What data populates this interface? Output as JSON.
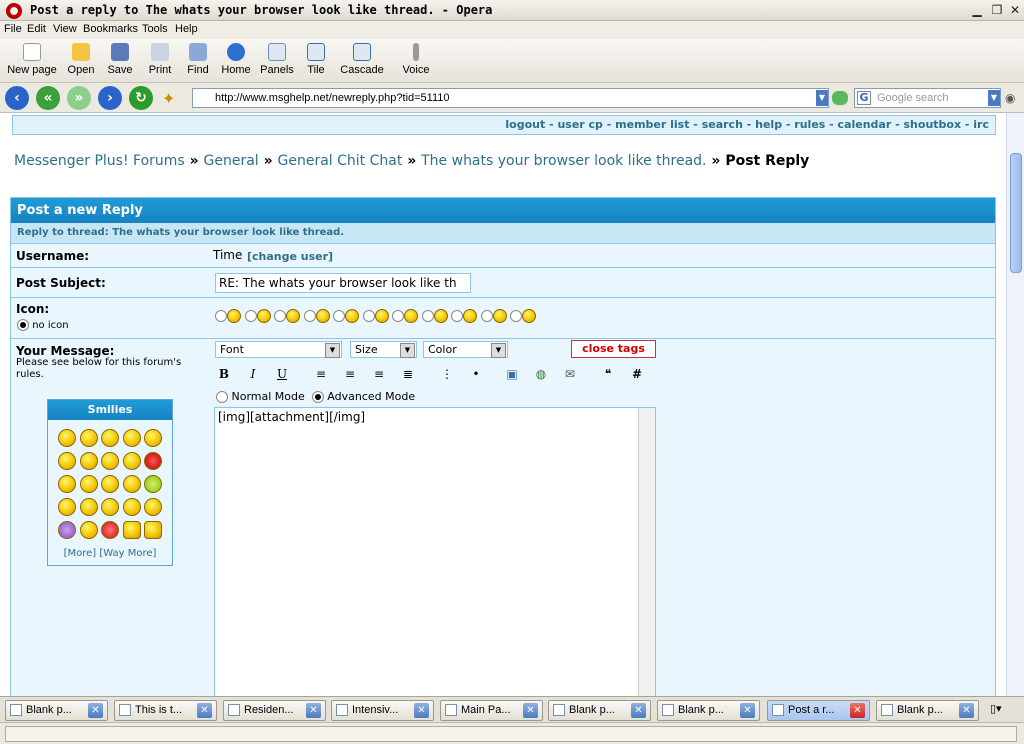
{
  "window": {
    "title": "Post a reply to The whats your browser look like thread. - Opera"
  },
  "menu": [
    "File",
    "Edit",
    "View",
    "Bookmarks",
    "Tools",
    "Help"
  ],
  "toolbar": [
    {
      "label": "New page",
      "icon": "new-page-icon"
    },
    {
      "label": "Open",
      "icon": "folder-icon"
    },
    {
      "label": "Save",
      "icon": "floppy-icon"
    },
    {
      "label": "Print",
      "icon": "printer-icon"
    },
    {
      "label": "Find",
      "icon": "binoculars-icon"
    },
    {
      "label": "Home",
      "icon": "home-icon"
    },
    {
      "label": "Panels",
      "icon": "panels-icon"
    },
    {
      "label": "Tile",
      "icon": "tile-icon"
    },
    {
      "label": "Cascade",
      "icon": "cascade-icon"
    },
    {
      "label": "Voice",
      "icon": "microphone-icon"
    }
  ],
  "address": {
    "url": "http://www.msghelp.net/newreply.php?tid=51110"
  },
  "search": {
    "placeholder": "Google search"
  },
  "page": {
    "toplinks": "logout - user cp - member list - search - help - rules - calendar - shoutbox - irc",
    "breadcrumb": {
      "part1": "Messenger Plus! Forums",
      "part2": "General",
      "part3": "General Chit Chat",
      "part4": "The whats your browser look like thread.",
      "current": "Post Reply",
      "sep": " » "
    },
    "form_title": "Post a new Reply",
    "reply_to": "Reply to thread: The whats your browser look like thread.",
    "username_label": "Username:",
    "username_value": "Time",
    "change_user": "[change user]",
    "subject_label": "Post Subject:",
    "subject_value": "RE: The whats your browser look like th",
    "icon_label": "Icon:",
    "no_icon": "no icon",
    "message_label": "Your Message:",
    "message_hint": "Please see below for this forum's rules.",
    "font_select": "Font",
    "size_select": "Size",
    "color_select": "Color",
    "close_tags": "close tags",
    "normal_mode": "Normal Mode",
    "advanced_mode": "Advanced Mode",
    "message_text": "[img][attachment][/img]",
    "smilies_title": "Smilies",
    "smilies_more": "[More]",
    "smilies_way_more": "[Way More]"
  },
  "tabs": [
    {
      "label": "Blank p..."
    },
    {
      "label": "This is t..."
    },
    {
      "label": "Residen..."
    },
    {
      "label": "Intensiv..."
    },
    {
      "label": "Main Pa..."
    },
    {
      "label": "Blank p..."
    },
    {
      "label": "Blank p..."
    },
    {
      "label": "Post a r...",
      "active": true
    },
    {
      "label": "Blank p..."
    }
  ]
}
